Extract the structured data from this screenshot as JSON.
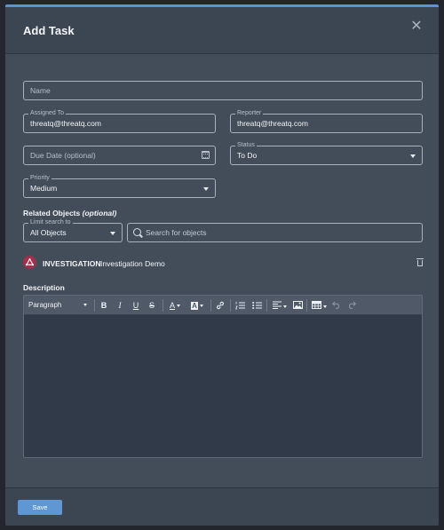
{
  "modal": {
    "title": "Add Task",
    "close_glyph": "✕"
  },
  "form": {
    "name": {
      "placeholder": "Name",
      "value": ""
    },
    "assigned_to": {
      "label": "Assigned To",
      "value": "threatq@threatq.com"
    },
    "reporter": {
      "label": "Reporter",
      "value": "threatq@threatq.com"
    },
    "due_date": {
      "placeholder": "Due Date (optional)",
      "value": ""
    },
    "status": {
      "label": "Status",
      "value": "To Do"
    },
    "priority": {
      "label": "Priority",
      "value": "Medium"
    }
  },
  "related_objects": {
    "title": "Related Objects",
    "optional": "(optional)",
    "limit_search": {
      "label": "Limit search to",
      "value": "All Objects"
    },
    "search": {
      "placeholder": "Search for objects"
    },
    "items": [
      {
        "type": "INVESTIGATION",
        "name": "Investigation Demo",
        "icon": "investigation-icon",
        "color": "#a2304c"
      }
    ]
  },
  "description": {
    "title": "Description",
    "toolbar": {
      "paragraph": "Paragraph",
      "bold": "B",
      "italic": "I",
      "underline": "U",
      "strike": "S",
      "font_color": "A",
      "bg_color": "A"
    }
  },
  "footer": {
    "save_label": "Save"
  },
  "colors": {
    "accent": "#5e97d4",
    "modal_bg": "#434d59",
    "editor_bg": "#313a48",
    "investigation": "#a2304c"
  }
}
